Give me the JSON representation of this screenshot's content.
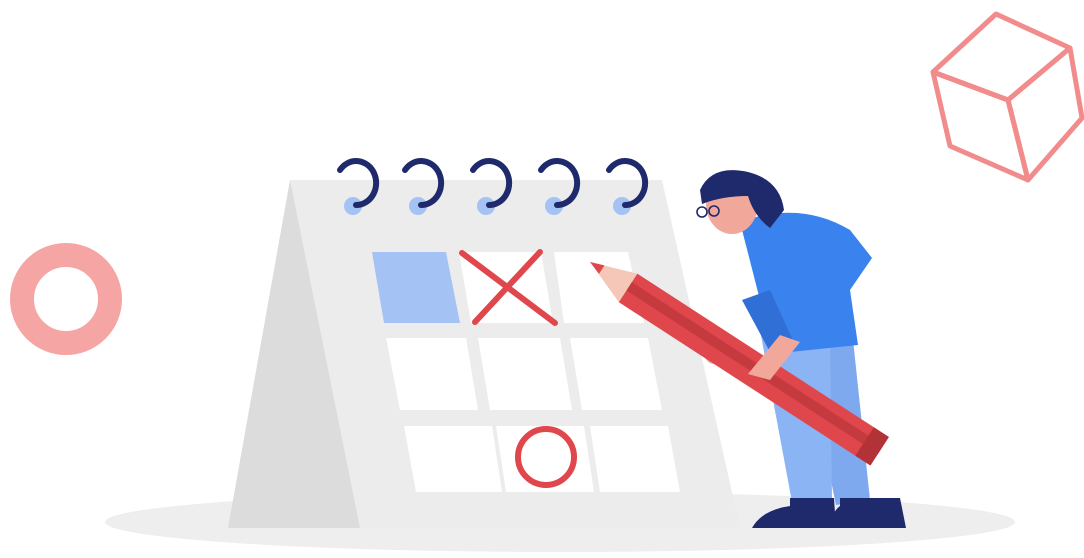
{
  "illustration": {
    "subject": "calendar-planning",
    "colors": {
      "background": "#ffffff",
      "floor_shadow": "#eeeeee",
      "calendar_face": "#ececec",
      "calendar_side": "#d9d9d9",
      "cell": "#ffffff",
      "highlight_cell": "#a4c2f4",
      "rings": "#1e2a6b",
      "ring_holes": "#a4c2f4",
      "mark": "#e0474c",
      "pencil": "#e0474c",
      "pencil_tip": "#f4c7b8",
      "shirt": "#3a82ee",
      "pants": "#8ab4f4",
      "hair_shoes": "#1e2a6b",
      "skin": "#f1a89a",
      "donut": "#f6a5a5",
      "cube": "#f28b8b"
    },
    "grid": {
      "rows": 3,
      "cols": 3,
      "marked_x": [
        0,
        1
      ],
      "marked_o": [
        2,
        1
      ],
      "highlighted": [
        0,
        0
      ]
    },
    "icons": [
      "calendar-icon",
      "pencil-icon",
      "cube-icon",
      "donut-icon"
    ]
  }
}
